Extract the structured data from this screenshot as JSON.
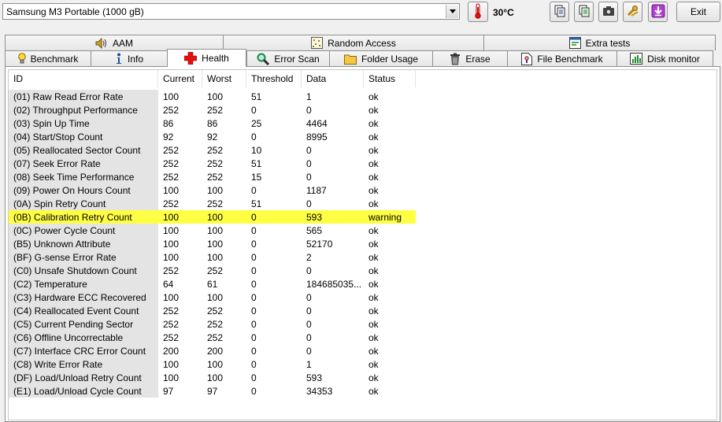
{
  "toolbar": {
    "drive_name": "Samsung M3 Portable (1000 gB)",
    "temperature": "30°C",
    "exit_label": "Exit"
  },
  "tabs_row1": [
    {
      "label": "AAM"
    },
    {
      "label": "Random Access"
    },
    {
      "label": "Extra tests"
    }
  ],
  "tabs_row2": [
    {
      "label": "Benchmark"
    },
    {
      "label": "Info"
    },
    {
      "label": "Health"
    },
    {
      "label": "Error Scan"
    },
    {
      "label": "Folder Usage"
    },
    {
      "label": "Erase"
    },
    {
      "label": "File Benchmark"
    },
    {
      "label": "Disk monitor"
    }
  ],
  "table": {
    "columns": [
      "ID",
      "Current",
      "Worst",
      "Threshold",
      "Data",
      "Status"
    ],
    "rows": [
      {
        "id": "(01) Raw Read Error Rate",
        "current": "100",
        "worst": "100",
        "threshold": "51",
        "data": "1",
        "status": "ok"
      },
      {
        "id": "(02) Throughput Performance",
        "current": "252",
        "worst": "252",
        "threshold": "0",
        "data": "0",
        "status": "ok"
      },
      {
        "id": "(03) Spin Up Time",
        "current": "86",
        "worst": "86",
        "threshold": "25",
        "data": "4464",
        "status": "ok"
      },
      {
        "id": "(04) Start/Stop Count",
        "current": "92",
        "worst": "92",
        "threshold": "0",
        "data": "8995",
        "status": "ok"
      },
      {
        "id": "(05) Reallocated Sector Count",
        "current": "252",
        "worst": "252",
        "threshold": "10",
        "data": "0",
        "status": "ok"
      },
      {
        "id": "(07) Seek Error Rate",
        "current": "252",
        "worst": "252",
        "threshold": "51",
        "data": "0",
        "status": "ok"
      },
      {
        "id": "(08) Seek Time Performance",
        "current": "252",
        "worst": "252",
        "threshold": "15",
        "data": "0",
        "status": "ok"
      },
      {
        "id": "(09) Power On Hours Count",
        "current": "100",
        "worst": "100",
        "threshold": "0",
        "data": "1187",
        "status": "ok"
      },
      {
        "id": "(0A) Spin Retry Count",
        "current": "252",
        "worst": "252",
        "threshold": "51",
        "data": "0",
        "status": "ok"
      },
      {
        "id": "(0B) Calibration Retry Count",
        "current": "100",
        "worst": "100",
        "threshold": "0",
        "data": "593",
        "status": "warning"
      },
      {
        "id": "(0C) Power Cycle Count",
        "current": "100",
        "worst": "100",
        "threshold": "0",
        "data": "565",
        "status": "ok"
      },
      {
        "id": "(B5) Unknown Attribute",
        "current": "100",
        "worst": "100",
        "threshold": "0",
        "data": "52170",
        "status": "ok"
      },
      {
        "id": "(BF) G-sense Error Rate",
        "current": "100",
        "worst": "100",
        "threshold": "0",
        "data": "2",
        "status": "ok"
      },
      {
        "id": "(C0) Unsafe Shutdown Count",
        "current": "252",
        "worst": "252",
        "threshold": "0",
        "data": "0",
        "status": "ok"
      },
      {
        "id": "(C2) Temperature",
        "current": "64",
        "worst": "61",
        "threshold": "0",
        "data": "184685035...",
        "status": "ok"
      },
      {
        "id": "(C3) Hardware ECC Recovered",
        "current": "100",
        "worst": "100",
        "threshold": "0",
        "data": "0",
        "status": "ok"
      },
      {
        "id": "(C4) Reallocated Event Count",
        "current": "252",
        "worst": "252",
        "threshold": "0",
        "data": "0",
        "status": "ok"
      },
      {
        "id": "(C5) Current Pending Sector",
        "current": "252",
        "worst": "252",
        "threshold": "0",
        "data": "0",
        "status": "ok"
      },
      {
        "id": "(C6) Offline Uncorrectable",
        "current": "252",
        "worst": "252",
        "threshold": "0",
        "data": "0",
        "status": "ok"
      },
      {
        "id": "(C7) Interface CRC Error Count",
        "current": "200",
        "worst": "200",
        "threshold": "0",
        "data": "0",
        "status": "ok"
      },
      {
        "id": "(C8) Write Error Rate",
        "current": "100",
        "worst": "100",
        "threshold": "0",
        "data": "1",
        "status": "ok"
      },
      {
        "id": "(DF) Load/Unload Retry Count",
        "current": "100",
        "worst": "100",
        "threshold": "0",
        "data": "593",
        "status": "ok"
      },
      {
        "id": "(E1) Load/Unload Cycle Count",
        "current": "97",
        "worst": "97",
        "threshold": "0",
        "data": "34353",
        "status": "ok"
      }
    ]
  },
  "colors": {
    "warning_highlight": "#ffff44",
    "id_column_bg": "#e4e4e4"
  }
}
